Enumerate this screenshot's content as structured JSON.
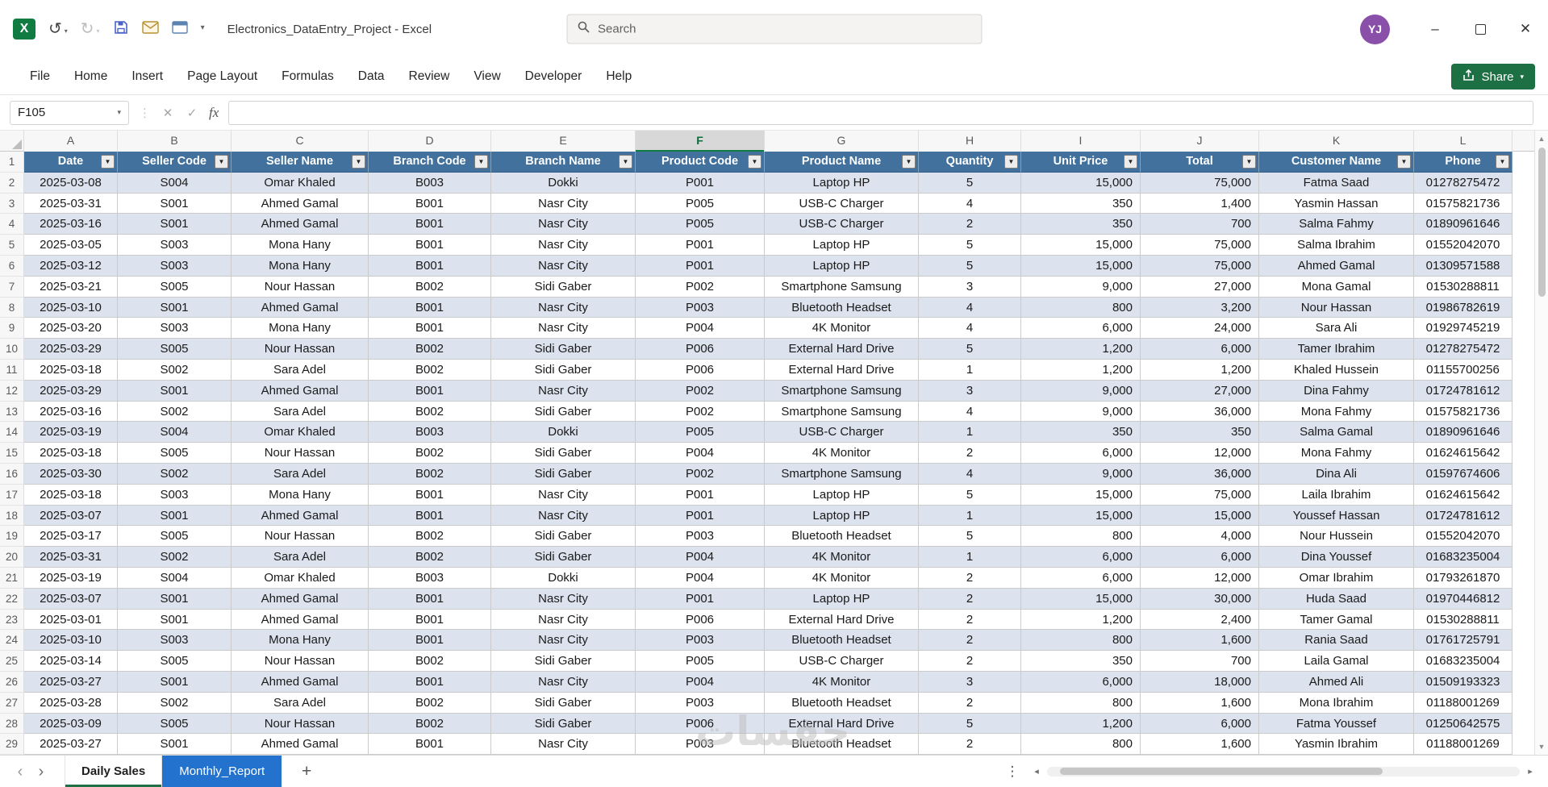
{
  "title_bar": {
    "app_title": "Electronics_DataEntry_Project - Excel",
    "search_placeholder": "Search",
    "avatar_initials": "YJ",
    "window_controls": {
      "minimize": "–",
      "close": "✕"
    }
  },
  "ribbon": {
    "tabs": [
      "File",
      "Home",
      "Insert",
      "Page Layout",
      "Formulas",
      "Data",
      "Review",
      "View",
      "Developer",
      "Help"
    ],
    "share_label": "Share"
  },
  "formula_bar": {
    "name_box": "F105",
    "formula_value": ""
  },
  "grid": {
    "column_letters": [
      "A",
      "B",
      "C",
      "D",
      "E",
      "F",
      "G",
      "H",
      "I",
      "J",
      "K",
      "L"
    ],
    "selected_column": "F",
    "headers": [
      "Date",
      "Seller Code",
      "Seller Name",
      "Branch Code",
      "Branch Name",
      "Product Code",
      "Product Name",
      "Quantity",
      "Unit Price",
      "Total",
      "Customer Name",
      "Phone"
    ],
    "rows": [
      [
        "2025-03-08",
        "S004",
        "Omar Khaled",
        "B003",
        "Dokki",
        "P001",
        "Laptop HP",
        "5",
        "15,000",
        "75,000",
        "Fatma Saad",
        "01278275472"
      ],
      [
        "2025-03-31",
        "S001",
        "Ahmed Gamal",
        "B001",
        "Nasr City",
        "P005",
        "USB-C Charger",
        "4",
        "350",
        "1,400",
        "Yasmin Hassan",
        "01575821736"
      ],
      [
        "2025-03-16",
        "S001",
        "Ahmed Gamal",
        "B001",
        "Nasr City",
        "P005",
        "USB-C Charger",
        "2",
        "350",
        "700",
        "Salma Fahmy",
        "01890961646"
      ],
      [
        "2025-03-05",
        "S003",
        "Mona Hany",
        "B001",
        "Nasr City",
        "P001",
        "Laptop HP",
        "5",
        "15,000",
        "75,000",
        "Salma Ibrahim",
        "01552042070"
      ],
      [
        "2025-03-12",
        "S003",
        "Mona Hany",
        "B001",
        "Nasr City",
        "P001",
        "Laptop HP",
        "5",
        "15,000",
        "75,000",
        "Ahmed Gamal",
        "01309571588"
      ],
      [
        "2025-03-21",
        "S005",
        "Nour Hassan",
        "B002",
        "Sidi Gaber",
        "P002",
        "Smartphone Samsung",
        "3",
        "9,000",
        "27,000",
        "Mona Gamal",
        "01530288811"
      ],
      [
        "2025-03-10",
        "S001",
        "Ahmed Gamal",
        "B001",
        "Nasr City",
        "P003",
        "Bluetooth Headset",
        "4",
        "800",
        "3,200",
        "Nour Hassan",
        "01986782619"
      ],
      [
        "2025-03-20",
        "S003",
        "Mona Hany",
        "B001",
        "Nasr City",
        "P004",
        "4K Monitor",
        "4",
        "6,000",
        "24,000",
        "Sara Ali",
        "01929745219"
      ],
      [
        "2025-03-29",
        "S005",
        "Nour Hassan",
        "B002",
        "Sidi Gaber",
        "P006",
        "External Hard Drive",
        "5",
        "1,200",
        "6,000",
        "Tamer Ibrahim",
        "01278275472"
      ],
      [
        "2025-03-18",
        "S002",
        "Sara Adel",
        "B002",
        "Sidi Gaber",
        "P006",
        "External Hard Drive",
        "1",
        "1,200",
        "1,200",
        "Khaled Hussein",
        "01155700256"
      ],
      [
        "2025-03-29",
        "S001",
        "Ahmed Gamal",
        "B001",
        "Nasr City",
        "P002",
        "Smartphone Samsung",
        "3",
        "9,000",
        "27,000",
        "Dina Fahmy",
        "01724781612"
      ],
      [
        "2025-03-16",
        "S002",
        "Sara Adel",
        "B002",
        "Sidi Gaber",
        "P002",
        "Smartphone Samsung",
        "4",
        "9,000",
        "36,000",
        "Mona Fahmy",
        "01575821736"
      ],
      [
        "2025-03-19",
        "S004",
        "Omar Khaled",
        "B003",
        "Dokki",
        "P005",
        "USB-C Charger",
        "1",
        "350",
        "350",
        "Salma Gamal",
        "01890961646"
      ],
      [
        "2025-03-18",
        "S005",
        "Nour Hassan",
        "B002",
        "Sidi Gaber",
        "P004",
        "4K Monitor",
        "2",
        "6,000",
        "12,000",
        "Mona Fahmy",
        "01624615642"
      ],
      [
        "2025-03-30",
        "S002",
        "Sara Adel",
        "B002",
        "Sidi Gaber",
        "P002",
        "Smartphone Samsung",
        "4",
        "9,000",
        "36,000",
        "Dina Ali",
        "01597674606"
      ],
      [
        "2025-03-18",
        "S003",
        "Mona Hany",
        "B001",
        "Nasr City",
        "P001",
        "Laptop HP",
        "5",
        "15,000",
        "75,000",
        "Laila Ibrahim",
        "01624615642"
      ],
      [
        "2025-03-07",
        "S001",
        "Ahmed Gamal",
        "B001",
        "Nasr City",
        "P001",
        "Laptop HP",
        "1",
        "15,000",
        "15,000",
        "Youssef Hassan",
        "01724781612"
      ],
      [
        "2025-03-17",
        "S005",
        "Nour Hassan",
        "B002",
        "Sidi Gaber",
        "P003",
        "Bluetooth Headset",
        "5",
        "800",
        "4,000",
        "Nour Hussein",
        "01552042070"
      ],
      [
        "2025-03-31",
        "S002",
        "Sara Adel",
        "B002",
        "Sidi Gaber",
        "P004",
        "4K Monitor",
        "1",
        "6,000",
        "6,000",
        "Dina Youssef",
        "01683235004"
      ],
      [
        "2025-03-19",
        "S004",
        "Omar Khaled",
        "B003",
        "Dokki",
        "P004",
        "4K Monitor",
        "2",
        "6,000",
        "12,000",
        "Omar Ibrahim",
        "01793261870"
      ],
      [
        "2025-03-07",
        "S001",
        "Ahmed Gamal",
        "B001",
        "Nasr City",
        "P001",
        "Laptop HP",
        "2",
        "15,000",
        "30,000",
        "Huda Saad",
        "01970446812"
      ],
      [
        "2025-03-01",
        "S001",
        "Ahmed Gamal",
        "B001",
        "Nasr City",
        "P006",
        "External Hard Drive",
        "2",
        "1,200",
        "2,400",
        "Tamer Gamal",
        "01530288811"
      ],
      [
        "2025-03-10",
        "S003",
        "Mona Hany",
        "B001",
        "Nasr City",
        "P003",
        "Bluetooth Headset",
        "2",
        "800",
        "1,600",
        "Rania Saad",
        "01761725791"
      ],
      [
        "2025-03-14",
        "S005",
        "Nour Hassan",
        "B002",
        "Sidi Gaber",
        "P005",
        "USB-C Charger",
        "2",
        "350",
        "700",
        "Laila Gamal",
        "01683235004"
      ],
      [
        "2025-03-27",
        "S001",
        "Ahmed Gamal",
        "B001",
        "Nasr City",
        "P004",
        "4K Monitor",
        "3",
        "6,000",
        "18,000",
        "Ahmed Ali",
        "01509193323"
      ],
      [
        "2025-03-28",
        "S002",
        "Sara Adel",
        "B002",
        "Sidi Gaber",
        "P003",
        "Bluetooth Headset",
        "2",
        "800",
        "1,600",
        "Mona Ibrahim",
        "01188001269"
      ],
      [
        "2025-03-09",
        "S005",
        "Nour Hassan",
        "B002",
        "Sidi Gaber",
        "P006",
        "External Hard Drive",
        "5",
        "1,200",
        "6,000",
        "Fatma Youssef",
        "01250642575"
      ],
      [
        "2025-03-27",
        "S001",
        "Ahmed Gamal",
        "B001",
        "Nasr City",
        "P003",
        "Bluetooth Headset",
        "2",
        "800",
        "1,600",
        "Yasmin Ibrahim",
        "01188001269"
      ]
    ]
  },
  "sheet_tabs": {
    "nav_left": "‹",
    "nav_right": "›",
    "tabs": [
      {
        "label": "Daily Sales",
        "active": true,
        "color": "#FFFFFF"
      },
      {
        "label": "Monthly_Report",
        "active": false,
        "color": "#2272CE"
      }
    ],
    "add_button": "+",
    "options_icon": "⋮"
  },
  "watermark": "حفسات",
  "icons": {
    "undo": "↺",
    "redo": "↻",
    "dropdown_caret": "▾",
    "cancel": "✕",
    "enter": "✓",
    "fx": "fx",
    "filter": "▼",
    "scroll_up": "▲",
    "scroll_down": "▼",
    "scroll_left": "◂",
    "scroll_right": "▸"
  },
  "colors": {
    "table_header": "#41719C",
    "banded_row": "#DCE3EE",
    "active_tab_underline": "#1E7145",
    "share_button": "#1D7044",
    "monthly_report_tab": "#2272CE",
    "avatar": "#8A4FA8",
    "excel_green": "#107C41"
  }
}
